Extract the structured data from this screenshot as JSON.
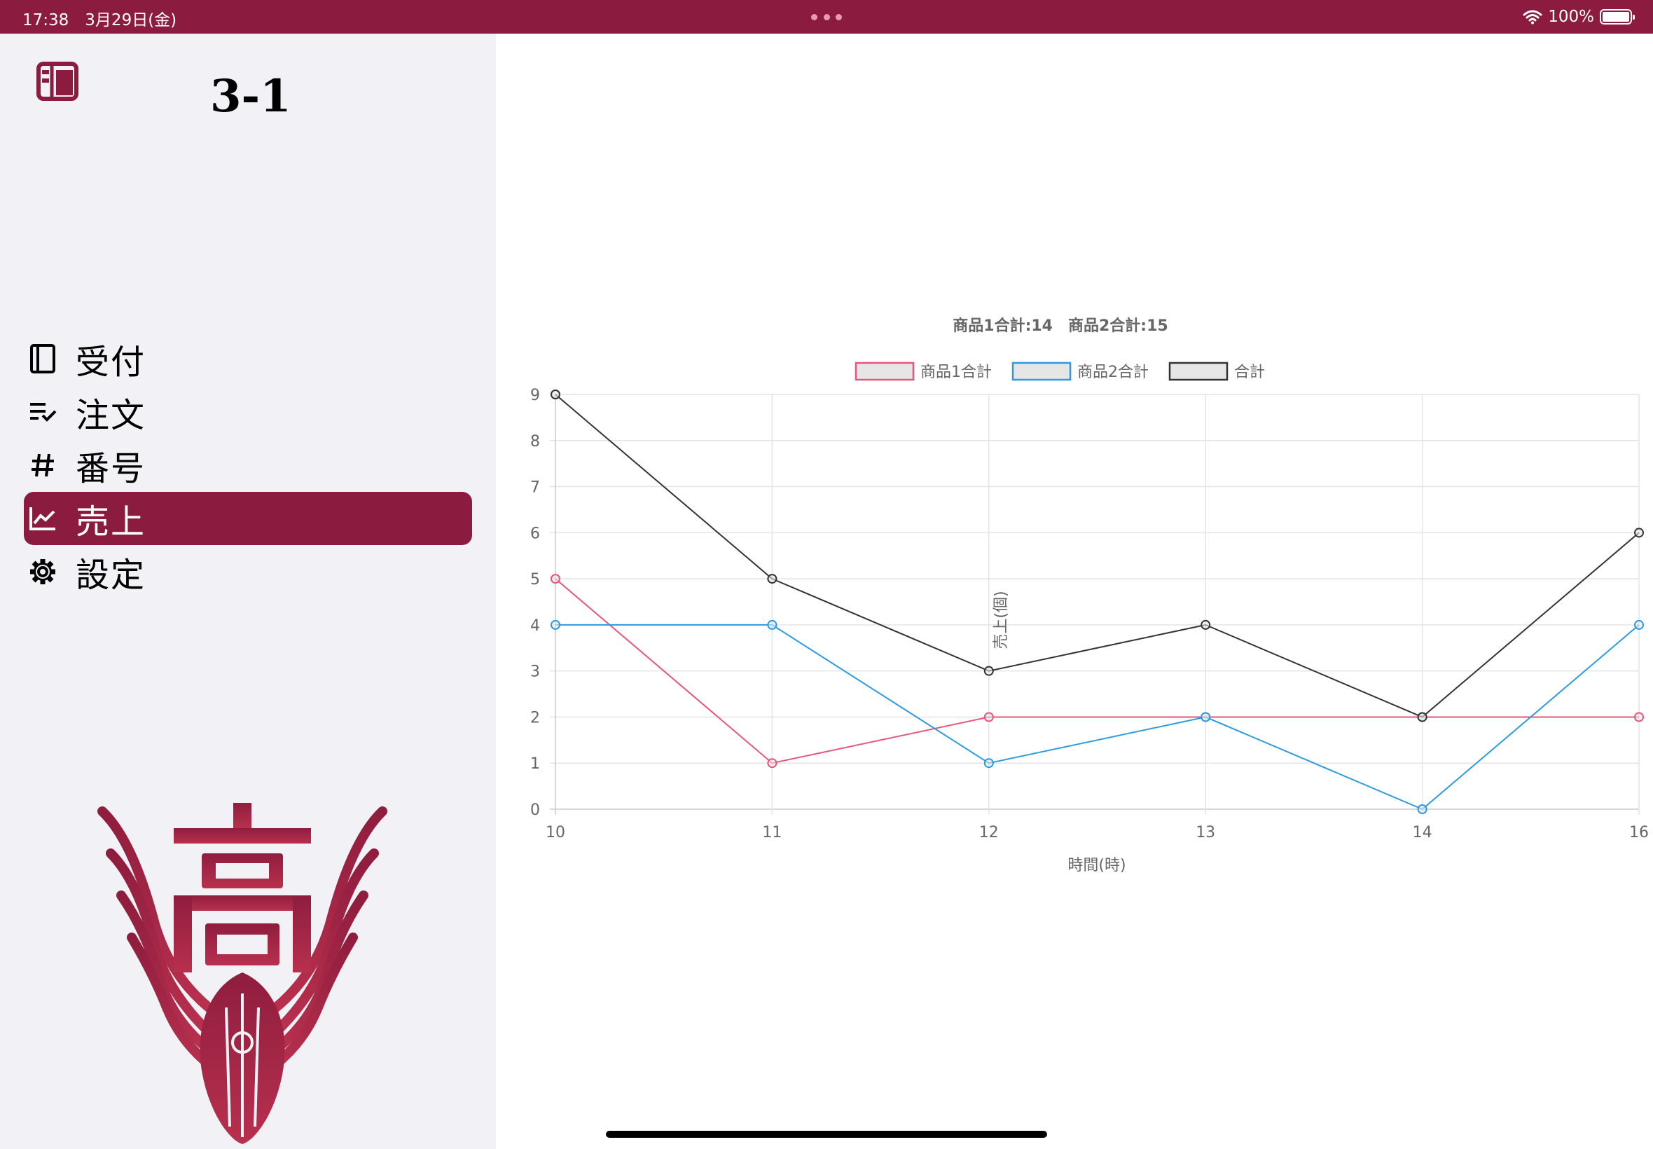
{
  "status_bar": {
    "time": "17:38",
    "date": "3月29日(金)",
    "battery": "100%"
  },
  "sidebar": {
    "title": "3-1",
    "items": [
      {
        "label": "受付",
        "icon": "book-icon"
      },
      {
        "label": "注文",
        "icon": "checklist-icon"
      },
      {
        "label": "番号",
        "icon": "hashtag-icon"
      },
      {
        "label": "売上",
        "icon": "chart-line-icon"
      },
      {
        "label": "設定",
        "icon": "gear-icon"
      }
    ],
    "active_index": 3,
    "emblem_text": "高"
  },
  "colors": {
    "accent": "#8c1b40",
    "series1": "#e8557a",
    "series2": "#2d9be0",
    "series3": "#333333"
  },
  "chart_data": {
    "type": "line",
    "title": "商品1合計:14　商品2合計:15",
    "xlabel": "時間(時)",
    "ylabel": "売上(個)",
    "categories": [
      "10",
      "11",
      "12",
      "13",
      "14",
      "16"
    ],
    "ylim": [
      0,
      9
    ],
    "yticks": [
      "0",
      "1",
      "2",
      "3",
      "4",
      "5",
      "6",
      "7",
      "8",
      "9"
    ],
    "grid": true,
    "legend": "top",
    "series": [
      {
        "name": "商品1合計",
        "values": [
          5,
          1,
          2,
          2,
          2,
          2
        ],
        "color": "#e8557a"
      },
      {
        "name": "商品2合計",
        "values": [
          4,
          4,
          1,
          2,
          0,
          4
        ],
        "color": "#2d9be0"
      },
      {
        "name": "合計",
        "values": [
          9,
          5,
          3,
          4,
          2,
          6
        ],
        "color": "#333333"
      }
    ]
  }
}
